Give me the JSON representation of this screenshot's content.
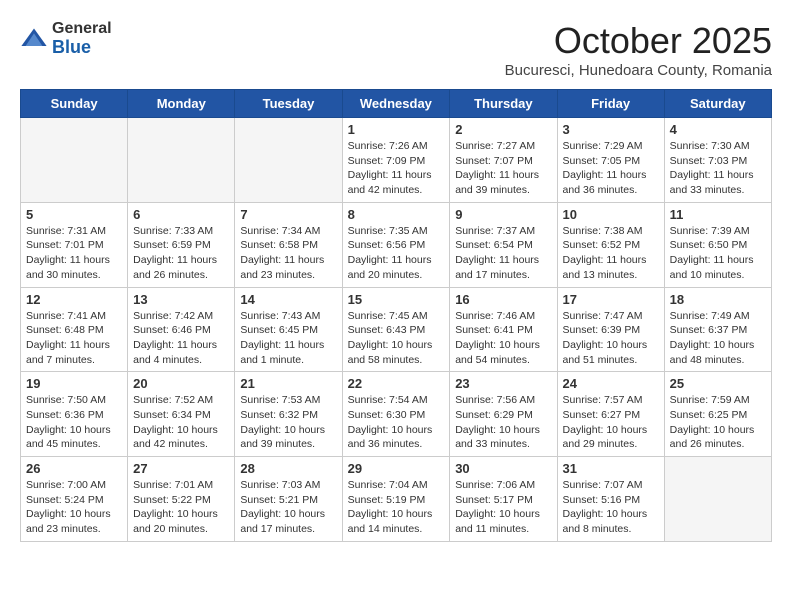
{
  "header": {
    "logo_general": "General",
    "logo_blue": "Blue",
    "month": "October 2025",
    "location": "Bucuresci, Hunedoara County, Romania"
  },
  "days_of_week": [
    "Sunday",
    "Monday",
    "Tuesday",
    "Wednesday",
    "Thursday",
    "Friday",
    "Saturday"
  ],
  "weeks": [
    [
      {
        "num": "",
        "info": ""
      },
      {
        "num": "",
        "info": ""
      },
      {
        "num": "",
        "info": ""
      },
      {
        "num": "1",
        "info": "Sunrise: 7:26 AM\nSunset: 7:09 PM\nDaylight: 11 hours and 42 minutes."
      },
      {
        "num": "2",
        "info": "Sunrise: 7:27 AM\nSunset: 7:07 PM\nDaylight: 11 hours and 39 minutes."
      },
      {
        "num": "3",
        "info": "Sunrise: 7:29 AM\nSunset: 7:05 PM\nDaylight: 11 hours and 36 minutes."
      },
      {
        "num": "4",
        "info": "Sunrise: 7:30 AM\nSunset: 7:03 PM\nDaylight: 11 hours and 33 minutes."
      }
    ],
    [
      {
        "num": "5",
        "info": "Sunrise: 7:31 AM\nSunset: 7:01 PM\nDaylight: 11 hours and 30 minutes."
      },
      {
        "num": "6",
        "info": "Sunrise: 7:33 AM\nSunset: 6:59 PM\nDaylight: 11 hours and 26 minutes."
      },
      {
        "num": "7",
        "info": "Sunrise: 7:34 AM\nSunset: 6:58 PM\nDaylight: 11 hours and 23 minutes."
      },
      {
        "num": "8",
        "info": "Sunrise: 7:35 AM\nSunset: 6:56 PM\nDaylight: 11 hours and 20 minutes."
      },
      {
        "num": "9",
        "info": "Sunrise: 7:37 AM\nSunset: 6:54 PM\nDaylight: 11 hours and 17 minutes."
      },
      {
        "num": "10",
        "info": "Sunrise: 7:38 AM\nSunset: 6:52 PM\nDaylight: 11 hours and 13 minutes."
      },
      {
        "num": "11",
        "info": "Sunrise: 7:39 AM\nSunset: 6:50 PM\nDaylight: 11 hours and 10 minutes."
      }
    ],
    [
      {
        "num": "12",
        "info": "Sunrise: 7:41 AM\nSunset: 6:48 PM\nDaylight: 11 hours and 7 minutes."
      },
      {
        "num": "13",
        "info": "Sunrise: 7:42 AM\nSunset: 6:46 PM\nDaylight: 11 hours and 4 minutes."
      },
      {
        "num": "14",
        "info": "Sunrise: 7:43 AM\nSunset: 6:45 PM\nDaylight: 11 hours and 1 minute."
      },
      {
        "num": "15",
        "info": "Sunrise: 7:45 AM\nSunset: 6:43 PM\nDaylight: 10 hours and 58 minutes."
      },
      {
        "num": "16",
        "info": "Sunrise: 7:46 AM\nSunset: 6:41 PM\nDaylight: 10 hours and 54 minutes."
      },
      {
        "num": "17",
        "info": "Sunrise: 7:47 AM\nSunset: 6:39 PM\nDaylight: 10 hours and 51 minutes."
      },
      {
        "num": "18",
        "info": "Sunrise: 7:49 AM\nSunset: 6:37 PM\nDaylight: 10 hours and 48 minutes."
      }
    ],
    [
      {
        "num": "19",
        "info": "Sunrise: 7:50 AM\nSunset: 6:36 PM\nDaylight: 10 hours and 45 minutes."
      },
      {
        "num": "20",
        "info": "Sunrise: 7:52 AM\nSunset: 6:34 PM\nDaylight: 10 hours and 42 minutes."
      },
      {
        "num": "21",
        "info": "Sunrise: 7:53 AM\nSunset: 6:32 PM\nDaylight: 10 hours and 39 minutes."
      },
      {
        "num": "22",
        "info": "Sunrise: 7:54 AM\nSunset: 6:30 PM\nDaylight: 10 hours and 36 minutes."
      },
      {
        "num": "23",
        "info": "Sunrise: 7:56 AM\nSunset: 6:29 PM\nDaylight: 10 hours and 33 minutes."
      },
      {
        "num": "24",
        "info": "Sunrise: 7:57 AM\nSunset: 6:27 PM\nDaylight: 10 hours and 29 minutes."
      },
      {
        "num": "25",
        "info": "Sunrise: 7:59 AM\nSunset: 6:25 PM\nDaylight: 10 hours and 26 minutes."
      }
    ],
    [
      {
        "num": "26",
        "info": "Sunrise: 7:00 AM\nSunset: 5:24 PM\nDaylight: 10 hours and 23 minutes."
      },
      {
        "num": "27",
        "info": "Sunrise: 7:01 AM\nSunset: 5:22 PM\nDaylight: 10 hours and 20 minutes."
      },
      {
        "num": "28",
        "info": "Sunrise: 7:03 AM\nSunset: 5:21 PM\nDaylight: 10 hours and 17 minutes."
      },
      {
        "num": "29",
        "info": "Sunrise: 7:04 AM\nSunset: 5:19 PM\nDaylight: 10 hours and 14 minutes."
      },
      {
        "num": "30",
        "info": "Sunrise: 7:06 AM\nSunset: 5:17 PM\nDaylight: 10 hours and 11 minutes."
      },
      {
        "num": "31",
        "info": "Sunrise: 7:07 AM\nSunset: 5:16 PM\nDaylight: 10 hours and 8 minutes."
      },
      {
        "num": "",
        "info": ""
      }
    ]
  ]
}
